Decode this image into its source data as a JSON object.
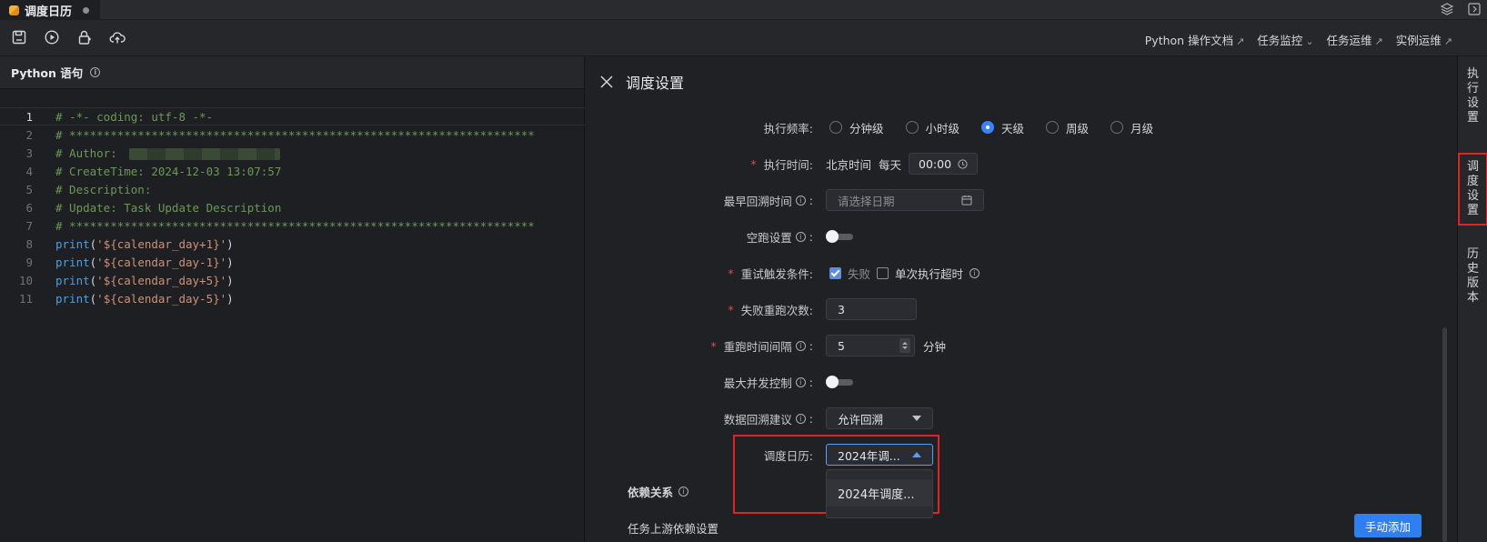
{
  "tab": {
    "title": "调度日历"
  },
  "toolbar": {
    "icons": [
      "save-icon",
      "run-icon",
      "publish-lock-icon",
      "cloud-upload-icon"
    ],
    "links": [
      {
        "label": "Python 操作文档",
        "suffix": "↗"
      },
      {
        "label": "任务监控",
        "suffix": "⌄"
      },
      {
        "label": "任务运维",
        "suffix": "↗"
      },
      {
        "label": "实例运维",
        "suffix": "↗"
      }
    ]
  },
  "editor": {
    "header": "Python 语句",
    "lines": [
      {
        "n": "1",
        "text": "# -*- coding: utf-8 -*-"
      },
      {
        "n": "2",
        "text": "# ********************************************************************"
      },
      {
        "n": "3",
        "text": "# Author: "
      },
      {
        "n": "4",
        "text": "# CreateTime: 2024-12-03 13:07:57"
      },
      {
        "n": "5",
        "text": "# Description:"
      },
      {
        "n": "6",
        "text": "# Update: Task Update Description"
      },
      {
        "n": "7",
        "text": "# ********************************************************************"
      },
      {
        "n": "8",
        "fn": "print",
        "str": "'${calendar_day+1}'"
      },
      {
        "n": "9",
        "fn": "print",
        "str": "'${calendar_day-1}'"
      },
      {
        "n": "10",
        "fn": "print",
        "str": "'${calendar_day+5}'"
      },
      {
        "n": "11",
        "fn": "print",
        "str": "'${calendar_day-5}'"
      }
    ]
  },
  "settings": {
    "title": "调度设置",
    "frequency": {
      "label": "执行频率:",
      "options": [
        "分钟级",
        "小时级",
        "天级",
        "周级",
        "月级"
      ],
      "selected": "天级"
    },
    "exec_time": {
      "label": "执行时间:",
      "tz": "北京时间",
      "every": "每天",
      "value": "00:00"
    },
    "earliest_backfill": {
      "label": "最早回溯时间",
      "placeholder": "请选择日期"
    },
    "dry_run": {
      "label": "空跑设置",
      "on": false
    },
    "retry_condition": {
      "label": "重试触发条件:",
      "opt1": "失败",
      "opt1_checked": true,
      "opt2": "单次执行超时",
      "opt2_checked": false
    },
    "retry_count": {
      "label": "失败重跑次数:",
      "value": "3"
    },
    "retry_interval": {
      "label": "重跑时间间隔",
      "value": "5",
      "unit": "分钟"
    },
    "max_concurrency": {
      "label": "最大并发控制",
      "on": false
    },
    "backfill_advice": {
      "label": "数据回溯建议",
      "value": "允许回溯"
    },
    "calendar": {
      "label": "调度日历:",
      "value": "2024年调...",
      "options": [
        "2024年调度..."
      ]
    },
    "dependency": {
      "title": "依赖关系",
      "upstream_label": "任务上游依赖设置",
      "add_button": "手动添加"
    }
  },
  "side_tabs": [
    {
      "label": "执行设置",
      "active": false
    },
    {
      "label": "调度设置",
      "active": true
    },
    {
      "label": "历史版本",
      "active": false
    }
  ],
  "colors": {
    "accent": "#2f7ff0",
    "highlight_box": "#e02424",
    "comment": "#6a9955",
    "string": "#ce9178",
    "function": "#4f9fe0"
  }
}
